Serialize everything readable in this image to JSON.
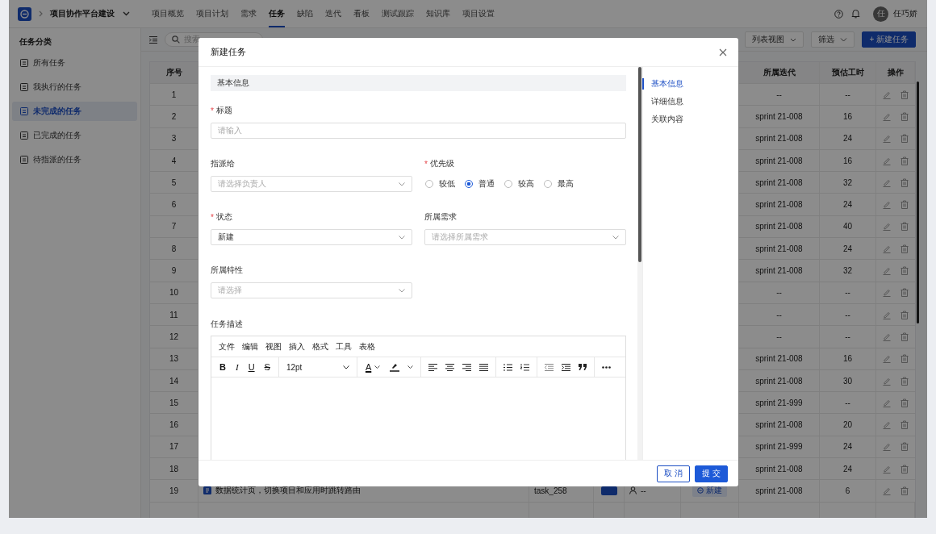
{
  "nav": {
    "project": "项目协作平台建设",
    "tabs": [
      {
        "label": "项目概览",
        "selected": false
      },
      {
        "label": "项目计划",
        "selected": false
      },
      {
        "label": "需求",
        "selected": false
      },
      {
        "label": "任务",
        "selected": true
      },
      {
        "label": "缺陷",
        "selected": false
      },
      {
        "label": "迭代",
        "selected": false
      },
      {
        "label": "看板",
        "selected": false
      },
      {
        "label": "测试跟踪",
        "selected": false
      },
      {
        "label": "知识库",
        "selected": false
      },
      {
        "label": "项目设置",
        "selected": false
      }
    ],
    "user": {
      "initial": "任",
      "name": "任巧娇"
    }
  },
  "sidebar": {
    "title": "任务分类",
    "items": [
      {
        "label": "所有任务",
        "selected": false
      },
      {
        "label": "我执行的任务",
        "selected": false
      },
      {
        "label": "未完成的任务",
        "selected": true
      },
      {
        "label": "已完成的任务",
        "selected": false
      },
      {
        "label": "待指派的任务",
        "selected": false
      }
    ]
  },
  "toolbar": {
    "search_placeholder": "搜索",
    "view_button": "列表视图",
    "filter_button": "筛选",
    "new_button": "+ 新建任务"
  },
  "table": {
    "columns": {
      "index": "序号",
      "iteration": "所属迭代",
      "hours": "预估工时",
      "actions": "操作"
    },
    "rows": [
      {
        "index": "1",
        "iteration": "--",
        "hours": "--"
      },
      {
        "index": "2",
        "iteration": "sprint 21-008",
        "hours": "16"
      },
      {
        "index": "3",
        "iteration": "sprint 21-008",
        "hours": "24"
      },
      {
        "index": "4",
        "iteration": "sprint 21-008",
        "hours": "16"
      },
      {
        "index": "5",
        "iteration": "sprint 21-008",
        "hours": "32"
      },
      {
        "index": "6",
        "iteration": "sprint 21-008",
        "hours": "24"
      },
      {
        "index": "7",
        "iteration": "sprint 21-008",
        "hours": "40"
      },
      {
        "index": "8",
        "iteration": "sprint 21-008",
        "hours": "24"
      },
      {
        "index": "9",
        "iteration": "sprint 21-008",
        "hours": "32"
      },
      {
        "index": "10",
        "iteration": "--",
        "hours": "--"
      },
      {
        "index": "11",
        "iteration": "--",
        "hours": "--"
      },
      {
        "index": "12",
        "iteration": "--",
        "hours": "--"
      },
      {
        "index": "13",
        "iteration": "sprint 21-008",
        "hours": "16"
      },
      {
        "index": "14",
        "iteration": "sprint 21-008",
        "hours": "30"
      },
      {
        "index": "15",
        "iteration": "sprint 21-999",
        "hours": "--"
      },
      {
        "index": "16",
        "iteration": "sprint 21-008",
        "hours": "20"
      },
      {
        "index": "17",
        "iteration": "sprint 21-999",
        "hours": "24"
      },
      {
        "index": "18",
        "iteration": "sprint 21-008",
        "hours": "24"
      },
      {
        "index": "19",
        "title": "数据统计页，切换项目和应用时跳转路由",
        "code": "task_258",
        "assignee": "--",
        "status": "新建",
        "iteration": "sprint 21-008",
        "hours": "6"
      }
    ]
  },
  "dialog": {
    "title": "新建任务",
    "section": "基本信息",
    "fields": [
      {
        "kind": "input",
        "label": "标题",
        "required_mark": "*",
        "placeholder": "请输入"
      },
      {
        "kind": "select",
        "label": "指派给",
        "placeholder": "请选择负责人"
      },
      {
        "kind": "radio",
        "label": "优先级",
        "required_mark": "*",
        "options": [
          {
            "label": "较低",
            "selected": false
          },
          {
            "label": "普通",
            "selected": true
          },
          {
            "label": "较高",
            "selected": false
          },
          {
            "label": "最高",
            "selected": false
          }
        ]
      },
      {
        "kind": "select",
        "label": "状态",
        "required_mark": "*",
        "value": "新建"
      },
      {
        "kind": "select",
        "label": "所属需求",
        "placeholder": "请选择所属需求"
      },
      {
        "kind": "select",
        "label": "所属特性",
        "placeholder": "请选择"
      }
    ],
    "editor": {
      "label": "任务描述",
      "menus": [
        "文件",
        "编辑",
        "视图",
        "插入",
        "格式",
        "工具",
        "表格"
      ],
      "format_buttons": [
        "B",
        "I",
        "U",
        "S"
      ],
      "font_size": "12pt",
      "font_color": "A"
    },
    "anchors": [
      {
        "label": "基本信息",
        "selected": true
      },
      {
        "label": "详细信息",
        "selected": false
      },
      {
        "label": "关联内容",
        "selected": false
      }
    ],
    "cancel_button": "取 消",
    "submit_button": "提 交"
  }
}
